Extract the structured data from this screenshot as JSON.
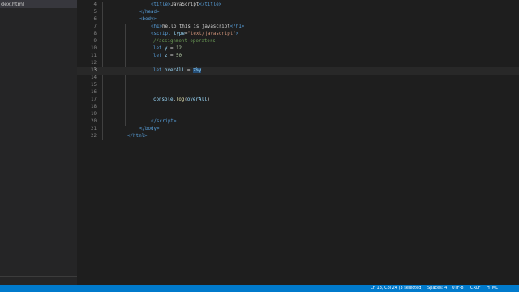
{
  "sidebar": {
    "open_file": "dex.html"
  },
  "editor": {
    "lines": [
      {
        "num": "4",
        "tokens": [
          {
            "c": "tag",
            "t": "<"
          },
          {
            "c": "tag",
            "t": "title"
          },
          {
            "c": "tag",
            "t": ">"
          },
          {
            "c": "txt",
            "t": "JavaScript"
          },
          {
            "c": "tag",
            "t": "</"
          },
          {
            "c": "tag",
            "t": "title"
          },
          {
            "c": "tag",
            "t": ">"
          }
        ]
      },
      {
        "num": "5",
        "tokens": [
          {
            "c": "tag",
            "t": "</"
          },
          {
            "c": "tag",
            "t": "head"
          },
          {
            "c": "tag",
            "t": ">"
          }
        ]
      },
      {
        "num": "6",
        "tokens": [
          {
            "c": "tag",
            "t": "<"
          },
          {
            "c": "tag",
            "t": "body"
          },
          {
            "c": "tag",
            "t": ">"
          }
        ]
      },
      {
        "num": "7",
        "tokens": [
          {
            "c": "tag",
            "t": "<"
          },
          {
            "c": "tag",
            "t": "h1"
          },
          {
            "c": "tag",
            "t": ">"
          },
          {
            "c": "txt",
            "t": "hello this is javascript"
          },
          {
            "c": "tag",
            "t": "</"
          },
          {
            "c": "tag",
            "t": "h1"
          },
          {
            "c": "tag",
            "t": ">"
          }
        ]
      },
      {
        "num": "8",
        "tokens": [
          {
            "c": "tag",
            "t": "<"
          },
          {
            "c": "tag",
            "t": "script"
          },
          {
            "c": "txt",
            "t": " "
          },
          {
            "c": "attr",
            "t": "type"
          },
          {
            "c": "txt",
            "t": "="
          },
          {
            "c": "str",
            "t": "\"text/javascript\""
          },
          {
            "c": "tag",
            "t": ">"
          }
        ]
      },
      {
        "num": "9",
        "tokens": [
          {
            "c": "cmt",
            "t": "//assignment operators"
          }
        ]
      },
      {
        "num": "10",
        "tokens": [
          {
            "c": "kw",
            "t": "let"
          },
          {
            "c": "txt",
            "t": " "
          },
          {
            "c": "var",
            "t": "y"
          },
          {
            "c": "txt",
            "t": " = "
          },
          {
            "c": "num",
            "t": "12"
          }
        ]
      },
      {
        "num": "11",
        "tokens": [
          {
            "c": "kw",
            "t": "let"
          },
          {
            "c": "txt",
            "t": " "
          },
          {
            "c": "var",
            "t": "z"
          },
          {
            "c": "txt",
            "t": " = "
          },
          {
            "c": "num",
            "t": "50"
          }
        ]
      },
      {
        "num": "12",
        "tokens": []
      },
      {
        "num": "13",
        "current": true,
        "tokens": [
          {
            "c": "kw",
            "t": "let"
          },
          {
            "c": "txt",
            "t": " "
          },
          {
            "c": "var",
            "t": "overAll"
          },
          {
            "c": "txt",
            "t": " = "
          },
          {
            "c": "var sel",
            "t": "z%y"
          }
        ]
      },
      {
        "num": "14",
        "tokens": []
      },
      {
        "num": "15",
        "tokens": []
      },
      {
        "num": "16",
        "tokens": []
      },
      {
        "num": "17",
        "tokens": [
          {
            "c": "var",
            "t": "console"
          },
          {
            "c": "txt",
            "t": "."
          },
          {
            "c": "fn",
            "t": "log"
          },
          {
            "c": "txt",
            "t": "("
          },
          {
            "c": "var",
            "t": "overAll"
          },
          {
            "c": "txt",
            "t": ")"
          }
        ]
      },
      {
        "num": "18",
        "tokens": []
      },
      {
        "num": "19",
        "tokens": []
      },
      {
        "num": "20",
        "tokens": [
          {
            "c": "tag",
            "t": "</"
          },
          {
            "c": "tag",
            "t": "script"
          },
          {
            "c": "tag",
            "t": ">"
          }
        ]
      },
      {
        "num": "21",
        "tokens": [
          {
            "c": "tag",
            "t": "</"
          },
          {
            "c": "tag",
            "t": "body"
          },
          {
            "c": "tag",
            "t": ">"
          }
        ]
      },
      {
        "num": "22",
        "tokens": [
          {
            "c": "tag",
            "t": "</"
          },
          {
            "c": "tag",
            "t": "html"
          },
          {
            "c": "tag",
            "t": ">"
          }
        ]
      }
    ]
  },
  "statusbar": {
    "cursor": "Ln 13, Col 24 (3 selected)",
    "spaces": "Spaces: 4",
    "encoding": "UTF-8",
    "eol": "CRLF",
    "language": "HTML"
  },
  "colors": {
    "statusbar": "#007acc",
    "editor_bg": "#1e1e1e",
    "sidebar_bg": "#252526"
  }
}
